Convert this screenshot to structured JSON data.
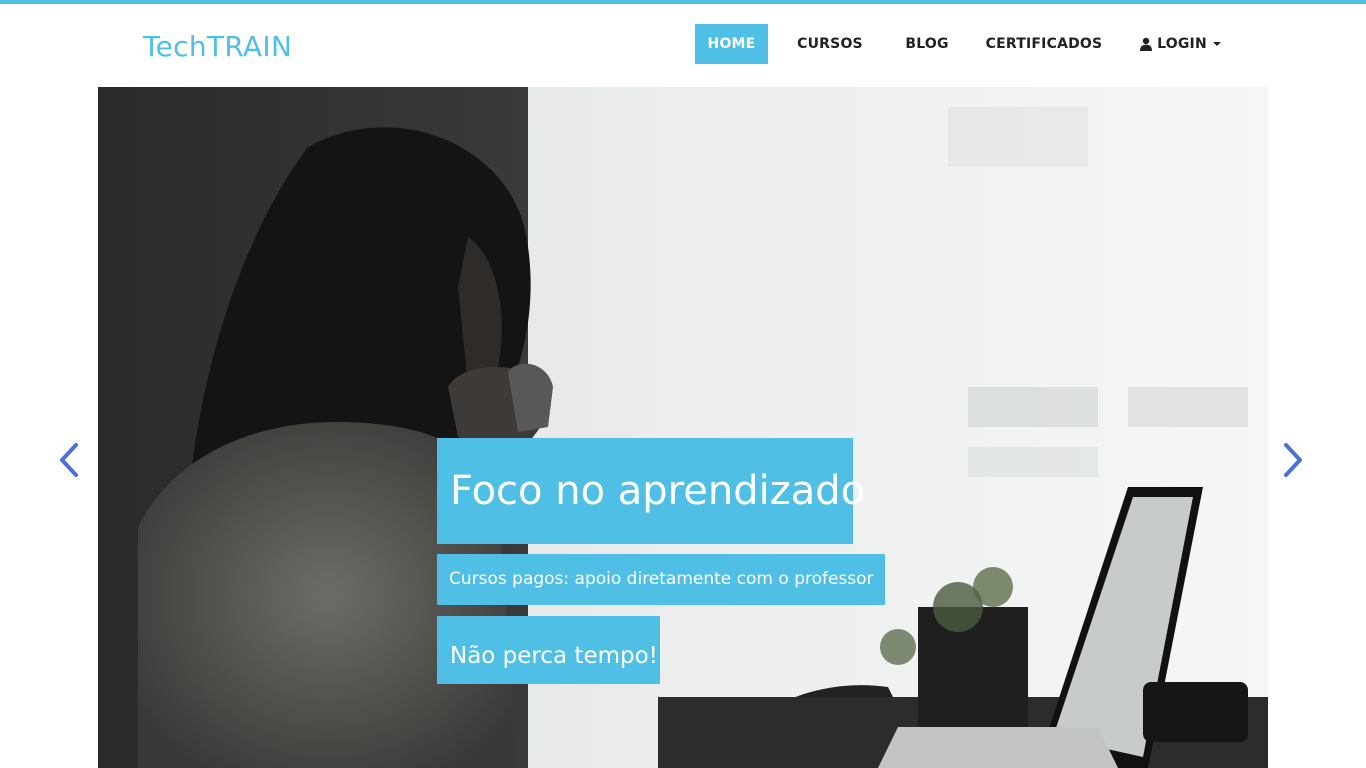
{
  "brand": {
    "name": "TechTRAIN"
  },
  "nav": {
    "home": "HOME",
    "cursos": "CURSOS",
    "blog": "BLOG",
    "certificados": "CERTIFICADOS",
    "login": "LOGIN"
  },
  "carousel": {
    "title": "Foco no aprendizado",
    "subtitle": "Cursos pagos: apoio diretamente com o professor",
    "cta": "Não perca tempo!"
  },
  "icons": {
    "user": "user-icon",
    "caret": "caret-down-icon",
    "prev": "chevron-left-icon",
    "next": "chevron-right-icon"
  },
  "colors": {
    "accent": "#4fbfe6",
    "arrow": "#4a6fd8",
    "nav_text": "#222222"
  }
}
